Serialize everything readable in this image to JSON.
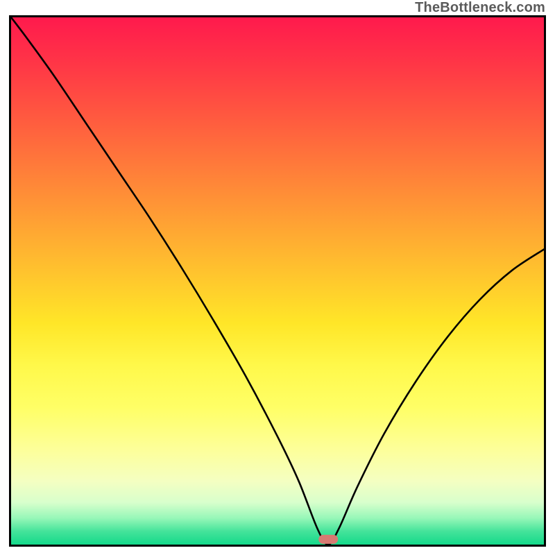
{
  "watermark": "TheBottleneck.com",
  "chart_data": {
    "type": "line",
    "title": "",
    "xlabel": "",
    "ylabel": "",
    "xlim": [
      0,
      100
    ],
    "ylim": [
      0,
      100
    ],
    "grid": false,
    "legend": false,
    "marker": {
      "x_pct": 59.5,
      "y_pct": 99.0,
      "w_pct": 3.6,
      "h_pct": 1.6,
      "color": "#d77a72"
    },
    "curve_points": [
      {
        "x": 0.0,
        "y": 100.0
      },
      {
        "x": 3.0,
        "y": 96.0
      },
      {
        "x": 8.0,
        "y": 89.0
      },
      {
        "x": 14.0,
        "y": 80.0
      },
      {
        "x": 20.0,
        "y": 71.0
      },
      {
        "x": 26.0,
        "y": 62.0
      },
      {
        "x": 32.0,
        "y": 52.5
      },
      {
        "x": 38.0,
        "y": 42.5
      },
      {
        "x": 44.0,
        "y": 32.0
      },
      {
        "x": 50.0,
        "y": 20.5
      },
      {
        "x": 54.0,
        "y": 12.0
      },
      {
        "x": 57.5,
        "y": 3.0
      },
      {
        "x": 59.5,
        "y": 0.0
      },
      {
        "x": 61.5,
        "y": 3.0
      },
      {
        "x": 65.0,
        "y": 11.0
      },
      {
        "x": 70.0,
        "y": 21.0
      },
      {
        "x": 76.0,
        "y": 31.0
      },
      {
        "x": 82.0,
        "y": 39.5
      },
      {
        "x": 88.0,
        "y": 46.5
      },
      {
        "x": 94.0,
        "y": 52.0
      },
      {
        "x": 100.0,
        "y": 56.0
      }
    ],
    "background_gradient": {
      "type": "vertical",
      "stops": [
        {
          "pos": 0.0,
          "color": "#ff1a4d"
        },
        {
          "pos": 0.5,
          "color": "#ffcc2e"
        },
        {
          "pos": 0.82,
          "color": "#fdff9a"
        },
        {
          "pos": 1.0,
          "color": "#14d98a"
        }
      ]
    }
  }
}
